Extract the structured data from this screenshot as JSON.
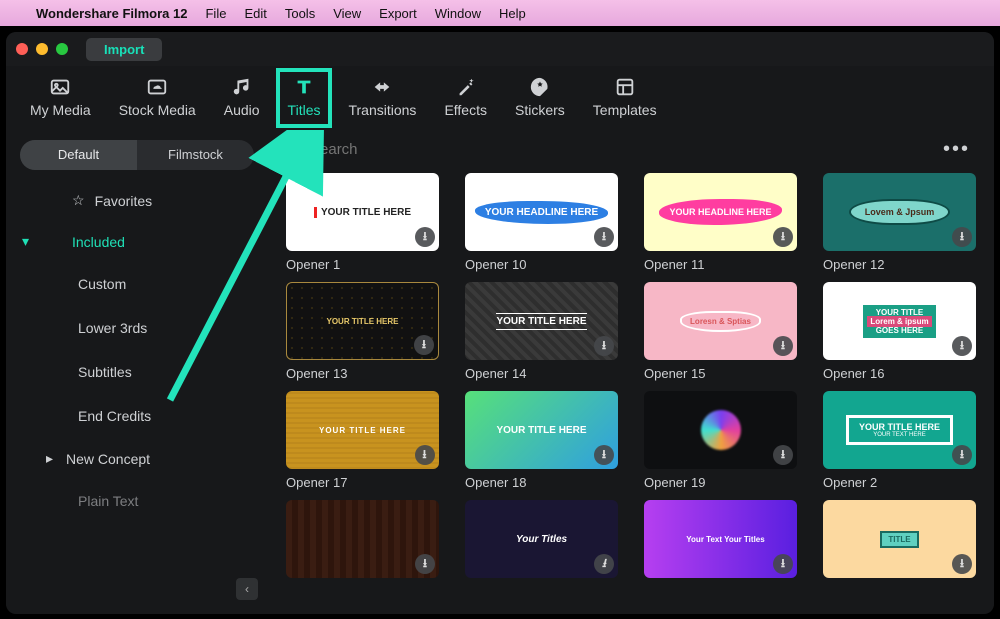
{
  "menubar": {
    "app_name": "Wondershare Filmora 12",
    "items": [
      "File",
      "Edit",
      "Tools",
      "View",
      "Export",
      "Window",
      "Help"
    ]
  },
  "titlebar": {
    "import_label": "Import"
  },
  "tooltabs": [
    {
      "id": "my-media",
      "label": "My Media"
    },
    {
      "id": "stock-media",
      "label": "Stock Media"
    },
    {
      "id": "audio",
      "label": "Audio"
    },
    {
      "id": "titles",
      "label": "Titles",
      "selected": true
    },
    {
      "id": "transitions",
      "label": "Transitions"
    },
    {
      "id": "effects",
      "label": "Effects"
    },
    {
      "id": "stickers",
      "label": "Stickers"
    },
    {
      "id": "templates",
      "label": "Templates"
    }
  ],
  "sidebar": {
    "tabs": {
      "default": "Default",
      "filmstock": "Filmstock",
      "active": "default"
    },
    "favorites_label": "Favorites",
    "section_label": "Included",
    "items": [
      "Custom",
      "Lower 3rds",
      "Subtitles",
      "End Credits",
      "New Concept",
      "Plain Text"
    ]
  },
  "search": {
    "placeholder": "Search"
  },
  "openers": [
    {
      "label": "Opener 1",
      "preview_text": "YOUR TITLE HERE",
      "cls": "t1"
    },
    {
      "label": "Opener 10",
      "preview_text": "YOUR HEADLINE HERE",
      "cls": "t2"
    },
    {
      "label": "Opener 11",
      "preview_text": "YOUR HEADLINE HERE",
      "cls": "t3"
    },
    {
      "label": "Opener 12",
      "preview_text": "Lovem & Jpsum",
      "cls": "t4"
    },
    {
      "label": "Opener 13",
      "preview_text": "YOUR TITLE HERE",
      "cls": "t5"
    },
    {
      "label": "Opener 14",
      "preview_text": "YOUR TITLE HERE",
      "cls": "t6"
    },
    {
      "label": "Opener 15",
      "preview_text": "Loresn & Sptias",
      "cls": "t7"
    },
    {
      "label": "Opener 16",
      "preview_text": "YOUR TITLE GOES HERE",
      "cls": "t8"
    },
    {
      "label": "Opener 17",
      "preview_text": "YOUR TITLE HERE",
      "cls": "t9"
    },
    {
      "label": "Opener 18",
      "preview_text": "YOUR TITLE HERE",
      "cls": "t10"
    },
    {
      "label": "Opener 19",
      "preview_text": "",
      "cls": "t11"
    },
    {
      "label": "Opener 2",
      "preview_text": "YOUR TITLE HERE",
      "cls": "t12"
    },
    {
      "label": "",
      "preview_text": "",
      "cls": "t13"
    },
    {
      "label": "",
      "preview_text": "Your Titles",
      "cls": "t14"
    },
    {
      "label": "",
      "preview_text": "Your Text Your Titles",
      "cls": "t15"
    },
    {
      "label": "",
      "preview_text": "",
      "cls": "t16"
    }
  ]
}
